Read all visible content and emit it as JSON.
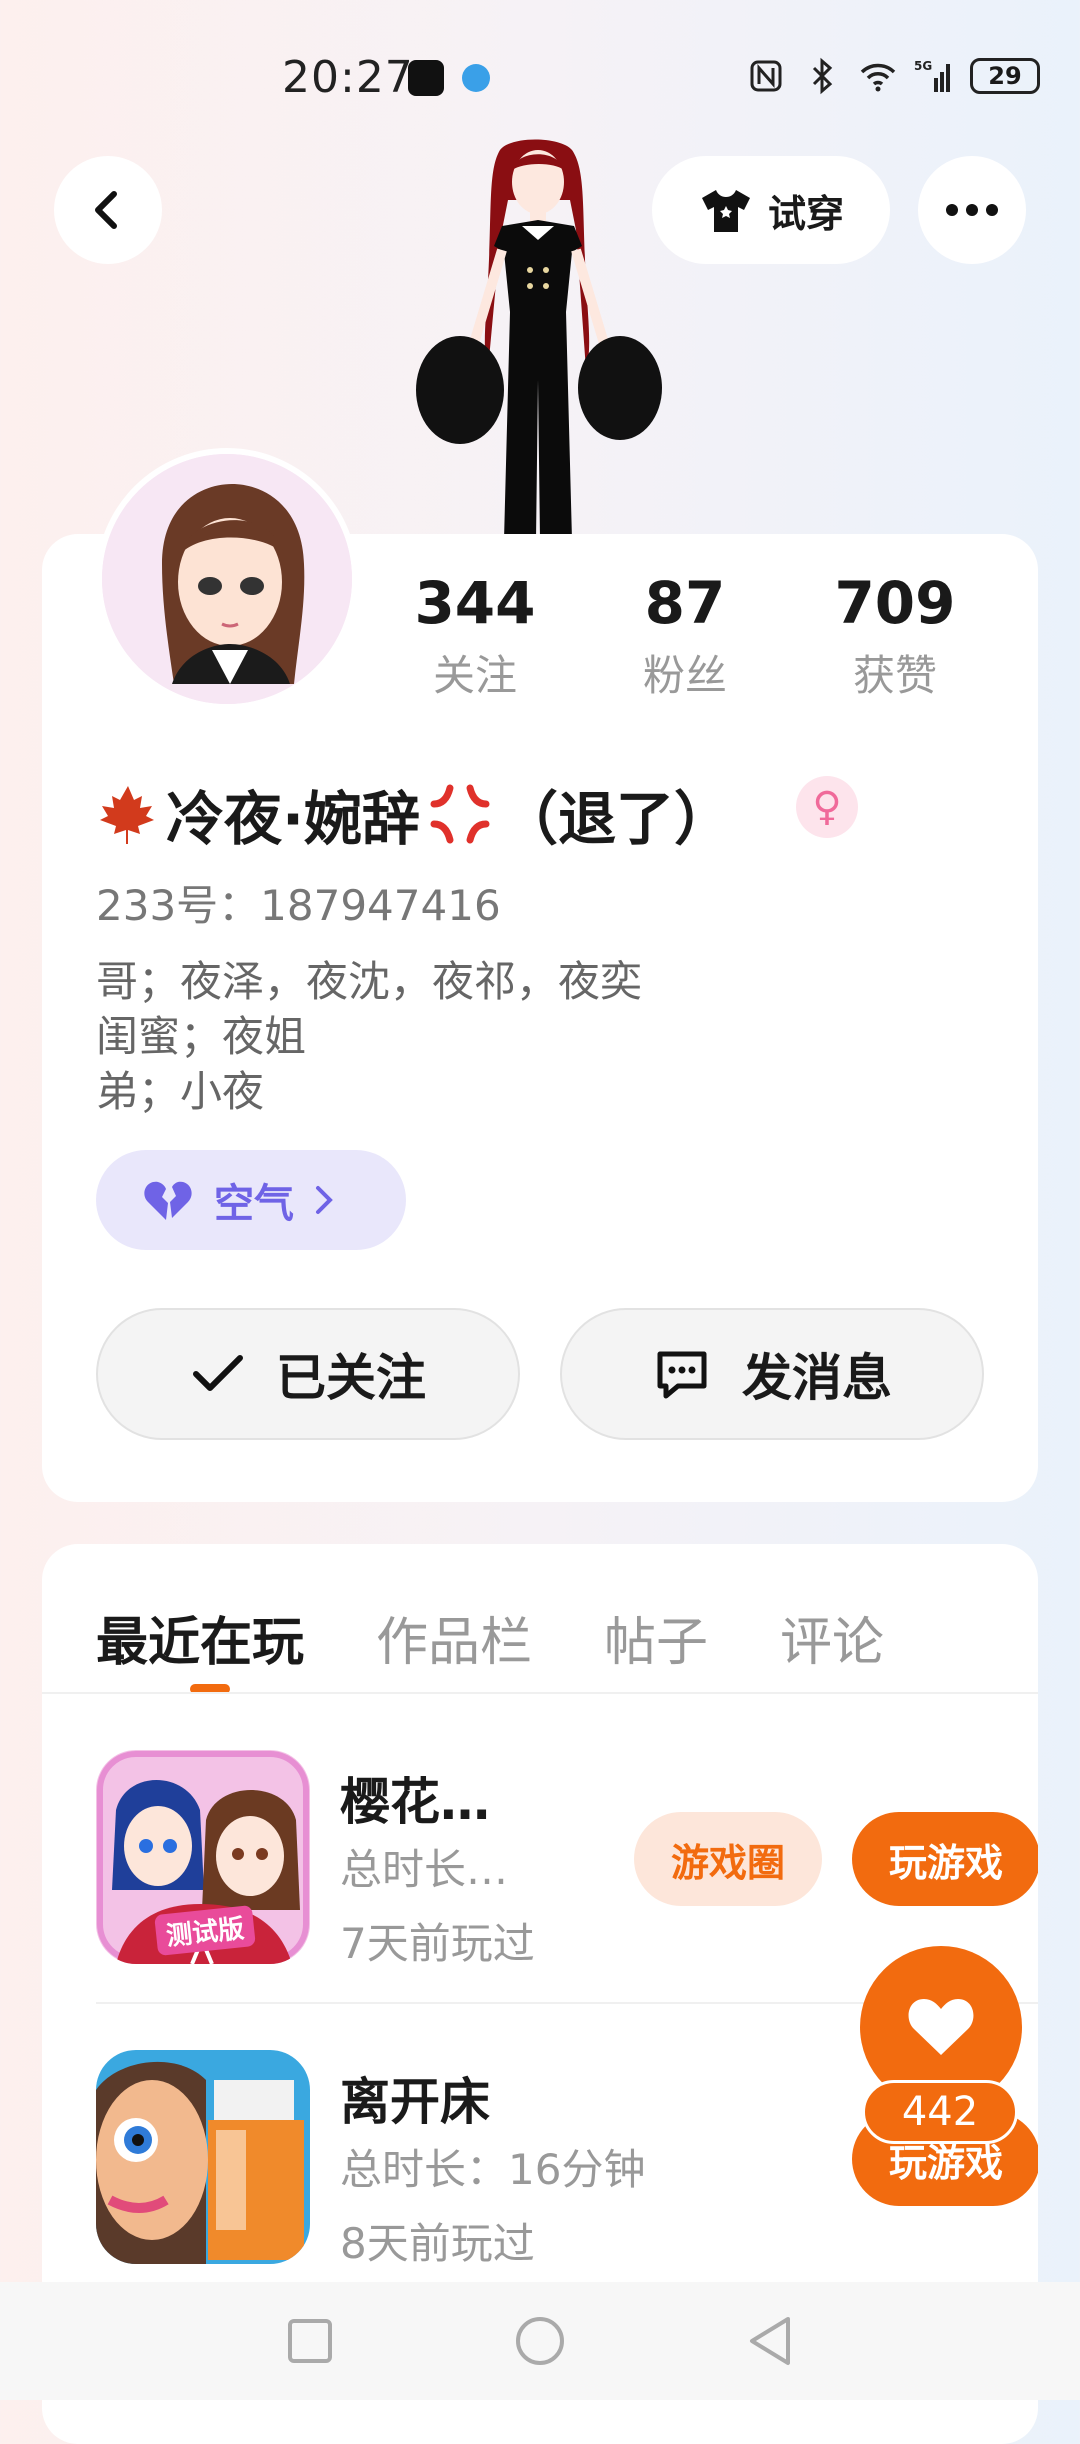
{
  "status_bar": {
    "time": "20:27",
    "battery": "29"
  },
  "header": {
    "tryon_label": "试穿"
  },
  "profile": {
    "stats": [
      {
        "value": "344",
        "label": "关注"
      },
      {
        "value": "87",
        "label": "粉丝"
      },
      {
        "value": "709",
        "label": "获赞"
      }
    ],
    "nickname": "冷夜·婉辞",
    "nickname_suffix": "（退了）",
    "uid": "233号：187947416",
    "bio": [
      "哥；夜泽，夜沈，夜祁，夜奕",
      "闺蜜；夜姐",
      "弟；小夜"
    ],
    "mood_tag": "空气",
    "follow_label": "已关注",
    "message_label": "发消息"
  },
  "tabs": [
    "最近在玩",
    "作品栏",
    "帖子",
    "评论"
  ],
  "games": [
    {
      "name": "樱花…",
      "duration": "总时长…",
      "last_played": "7天前玩过",
      "circle_label": "游戏圈",
      "play_label": "玩游戏",
      "icon_badge": "测试版"
    },
    {
      "name": "离开床",
      "duration": "总时长：16分钟",
      "last_played": "8天前玩过",
      "play_label": "玩游戏"
    }
  ],
  "like": {
    "count": "442"
  },
  "colors": {
    "accent": "#f26b0f",
    "mood": "#6f63e6"
  }
}
